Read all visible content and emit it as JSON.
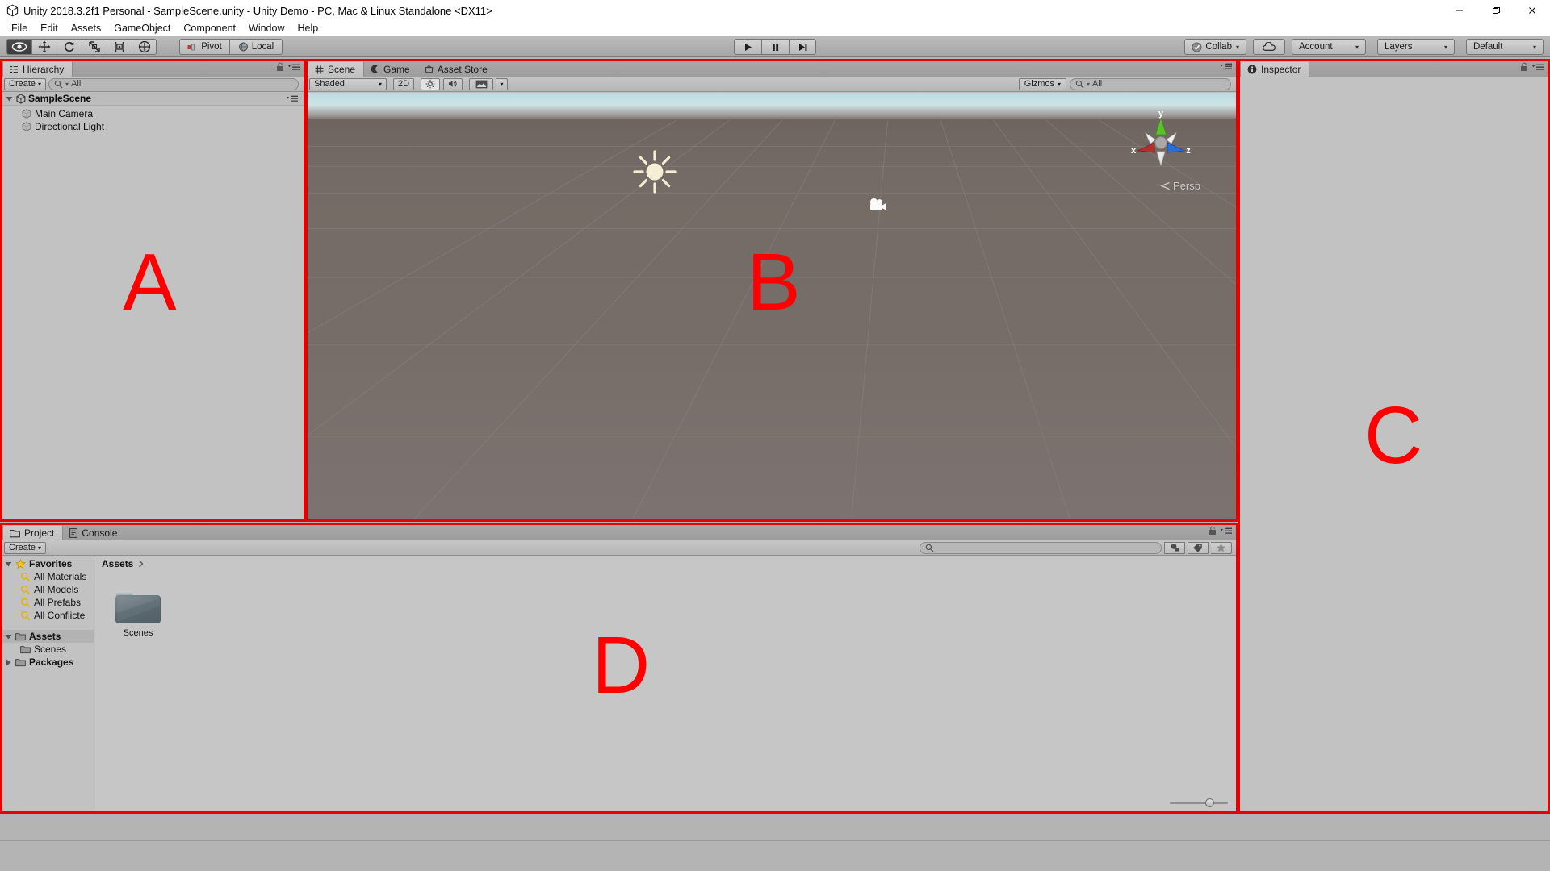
{
  "window": {
    "title": "Unity 2018.3.2f1 Personal - SampleScene.unity - Unity Demo - PC, Mac & Linux Standalone <DX11>",
    "minimize_label": "Minimize",
    "maximize_label": "Restore",
    "close_label": "Close"
  },
  "menubar": {
    "items": [
      {
        "label": "File"
      },
      {
        "label": "Edit"
      },
      {
        "label": "Assets"
      },
      {
        "label": "GameObject"
      },
      {
        "label": "Component"
      },
      {
        "label": "Window"
      },
      {
        "label": "Help"
      }
    ]
  },
  "toolbar": {
    "tools": [
      {
        "name": "hand-tool",
        "icon": "eye-icon",
        "active": true
      },
      {
        "name": "move-tool",
        "icon": "move-icon",
        "active": false
      },
      {
        "name": "rotate-tool",
        "icon": "rotate-icon",
        "active": false
      },
      {
        "name": "scale-tool",
        "icon": "scale-icon",
        "active": false
      },
      {
        "name": "rect-tool",
        "icon": "rect-icon",
        "active": false
      },
      {
        "name": "transform-tool",
        "icon": "transform-icon",
        "active": false
      }
    ],
    "pivot_label": "Pivot",
    "local_label": "Local",
    "play_label": "Play",
    "pause_label": "Pause",
    "step_label": "Step",
    "collab_label": "Collab",
    "cloud_label": "Services",
    "account_label": "Account",
    "layers_label": "Layers",
    "layout_label": "Default"
  },
  "hierarchy": {
    "tab_label": "Hierarchy",
    "create_label": "Create",
    "search_value": "All",
    "scene_name": "SampleScene",
    "objects": [
      {
        "label": "Main Camera"
      },
      {
        "label": "Directional Light"
      }
    ]
  },
  "scene": {
    "tabs": [
      {
        "label": "Scene",
        "icon": "grid-icon",
        "selected": true
      },
      {
        "label": "Game",
        "icon": "gamepad-icon",
        "selected": false
      },
      {
        "label": "Asset Store",
        "icon": "store-icon",
        "selected": false
      }
    ],
    "shading_mode": "Shaded",
    "two_d_label": "2D",
    "lighting_label": "Lighting toggle",
    "audio_label": "Audio toggle",
    "effects_label": "Effects",
    "gizmos_label": "Gizmos",
    "search_value": "All",
    "persp_label": "Persp",
    "axis_x": "x",
    "axis_y": "y",
    "axis_z": "z",
    "gizmo_sun": "directional-light-gizmo",
    "gizmo_camera": "camera-gizmo"
  },
  "inspector": {
    "tab_label": "Inspector"
  },
  "project": {
    "tabs": [
      {
        "label": "Project",
        "icon": "folder-icon",
        "selected": true
      },
      {
        "label": "Console",
        "icon": "console-icon",
        "selected": false
      }
    ],
    "create_label": "Create",
    "search_value": "",
    "search_placeholder": "",
    "favorites_label": "Favorites",
    "favorites": [
      {
        "label": "All Materials"
      },
      {
        "label": "All Models"
      },
      {
        "label": "All Prefabs"
      },
      {
        "label": "All Conflicte"
      }
    ],
    "assets_label": "Assets",
    "assets_children": [
      {
        "label": "Scenes"
      }
    ],
    "packages_label": "Packages",
    "breadcrumb": "Assets",
    "items": [
      {
        "label": "Scenes",
        "type": "folder"
      }
    ]
  },
  "regions": [
    {
      "label": "A",
      "name": "region-label-a"
    },
    {
      "label": "B",
      "name": "region-label-b"
    },
    {
      "label": "C",
      "name": "region-label-c"
    },
    {
      "label": "D",
      "name": "region-label-d"
    }
  ],
  "colors": {
    "region_outline": "#e80000",
    "region_text": "#ff0000",
    "panel_bg": "#c2c2c2",
    "toolbar_bg": "#b0b0b0",
    "axis_x": "#b03030",
    "axis_y": "#5cc22c",
    "axis_z": "#2b6fd4"
  }
}
